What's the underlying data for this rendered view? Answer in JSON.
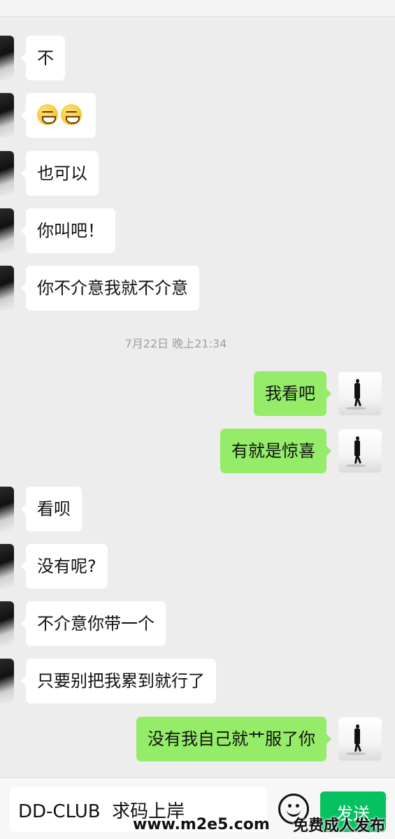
{
  "messages": [
    {
      "side": "left",
      "text": "不"
    },
    {
      "side": "left",
      "text": "😆😆",
      "emoji_count": 2
    },
    {
      "side": "left",
      "text": "也可以"
    },
    {
      "side": "left",
      "text": "你叫吧！"
    },
    {
      "side": "left",
      "text": "你不介意我就不介意"
    },
    {
      "side": "right",
      "text": "我看吧"
    },
    {
      "side": "right",
      "text": "有就是惊喜"
    },
    {
      "side": "left",
      "text": "看呗"
    },
    {
      "side": "left",
      "text": "没有呢?"
    },
    {
      "side": "left",
      "text": "不介意你带一个"
    },
    {
      "side": "left",
      "text": "只要别把我累到就行了"
    },
    {
      "side": "right",
      "text": "没有我自己就艹服了你"
    }
  ],
  "timestamp": "7月22日 晚上21:34",
  "input": {
    "value": "DD-CLUB  求码上岸"
  },
  "send_label": "发送",
  "watermark": {
    "site": "www.m2e5.com",
    "slogan": "免费成人发布"
  },
  "colors": {
    "green_bubble": "#95ec69",
    "send_button": "#07c160",
    "background": "#ededed"
  }
}
